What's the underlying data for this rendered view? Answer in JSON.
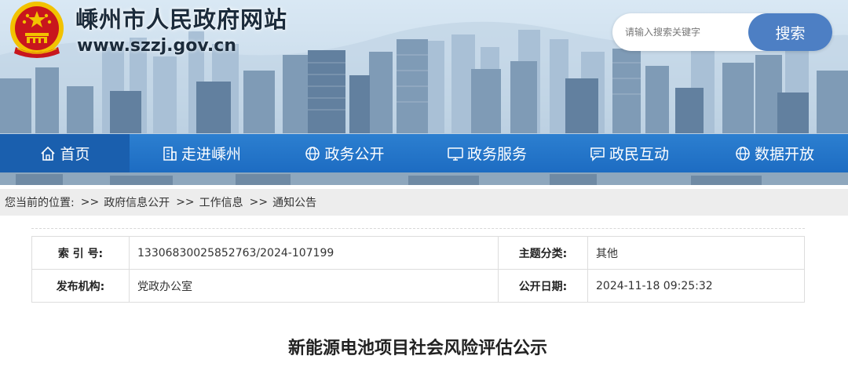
{
  "header": {
    "site_title": "嵊州市人民政府网站",
    "site_url": "www.szzj.gov.cn",
    "search_placeholder": "请输入搜索关键字",
    "search_button": "搜索"
  },
  "nav": {
    "items": [
      {
        "label": "首页",
        "icon": "home-icon"
      },
      {
        "label": "走进嵊州",
        "icon": "building-icon"
      },
      {
        "label": "政务公开",
        "icon": "globe-icon"
      },
      {
        "label": "政务服务",
        "icon": "monitor-icon"
      },
      {
        "label": "政民互动",
        "icon": "chat-icon"
      },
      {
        "label": "数据开放",
        "icon": "globe-icon"
      }
    ]
  },
  "breadcrumb": {
    "prefix": "您当前的位置:",
    "separator": ">>",
    "items": [
      "政府信息公开",
      "工作信息",
      "通知公告"
    ]
  },
  "meta": {
    "index_label": "索 引 号:",
    "index_value": "13306830025852763/2024-107199",
    "category_label": "主题分类:",
    "category_value": "其他",
    "publisher_label": "发布机构:",
    "publisher_value": "党政办公室",
    "date_label": "公开日期:",
    "date_value": "2024-11-18 09:25:32"
  },
  "article": {
    "title": "新能源电池项目社会风险评估公示"
  },
  "colors": {
    "nav_blue": "#1d6cc2",
    "search_button": "#4d7fc4",
    "emblem_red": "#c8161d",
    "emblem_gold": "#f2c200"
  }
}
